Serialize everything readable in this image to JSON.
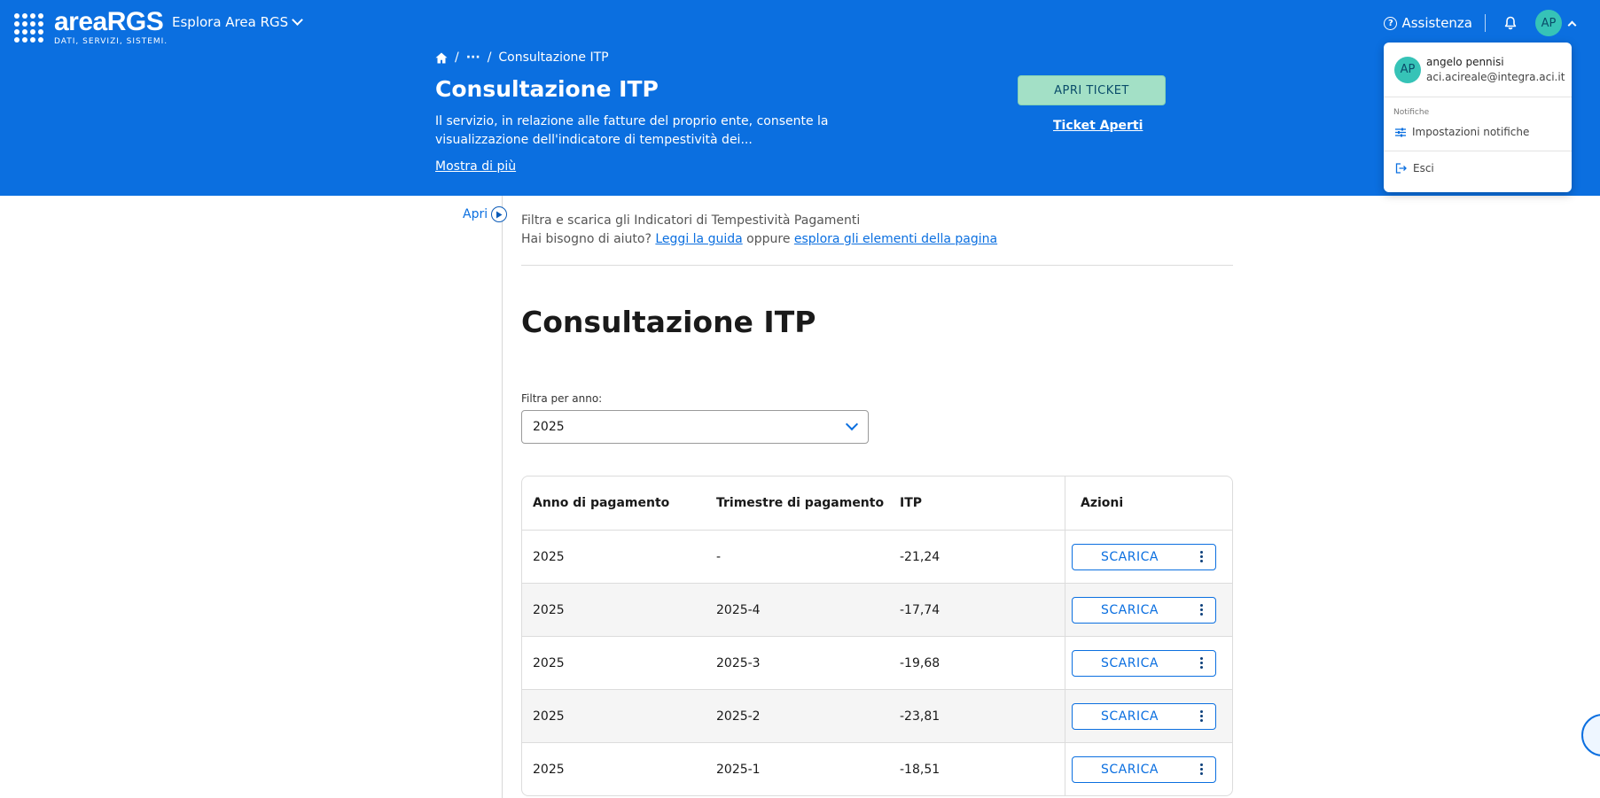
{
  "header": {
    "logo_word": "areaRGS",
    "logo_sub": "DATI, SERVIZI, SISTEMI.",
    "explore_label": "Esplora Area RGS",
    "assist_label": "Assistenza",
    "avatar_initials": "AP",
    "breadcrumb": {
      "ellipsis": "···",
      "sep": "/",
      "current": "Consultazione ITP"
    },
    "title": "Consultazione ITP",
    "description": "Il servizio, in relazione alle fatture del proprio ente, consente la visualizzazione dell'indicatore di tempestività dei...",
    "show_more": "Mostra di più",
    "ticket_button": "APRI TICKET",
    "ticket_link": "Ticket Aperti"
  },
  "user_menu": {
    "initials": "AP",
    "name": "angelo pennisi",
    "email": "aci.acireale@integra.aci.it",
    "section_label": "Notifiche",
    "notification_settings": "Impostazioni notifiche",
    "logout": "Esci"
  },
  "rail": {
    "open_label": "Apri"
  },
  "intro": {
    "line1": "Filtra e scarica gli Indicatori di Tempestività Pagamenti",
    "help_prefix": "Hai bisogno di aiuto?",
    "guide_link": "Leggi la guida",
    "connector": "oppure",
    "explore_link": "esplora gli elementi della pagina"
  },
  "main": {
    "title": "Consultazione ITP",
    "filter_label": "Filtra per anno:",
    "filter_value": "2025"
  },
  "table": {
    "headers": [
      "Anno di pagamento",
      "Trimestre di pagamento",
      "ITP",
      "Azioni"
    ],
    "action_label": "SCARICA",
    "rows": [
      {
        "anno": "2025",
        "trimestre": "-",
        "itp": "-21,24"
      },
      {
        "anno": "2025",
        "trimestre": "2025-4",
        "itp": "-17,74"
      },
      {
        "anno": "2025",
        "trimestre": "2025-3",
        "itp": "-19,68"
      },
      {
        "anno": "2025",
        "trimestre": "2025-2",
        "itp": "-23,81"
      },
      {
        "anno": "2025",
        "trimestre": "2025-1",
        "itp": "-18,51"
      }
    ]
  },
  "colors": {
    "brand_blue": "#0b6fe0",
    "ticket_green": "#a3e0c6",
    "avatar_teal": "#36c3b7"
  },
  "icons": [
    "home-icon",
    "help-circle-icon",
    "bell-icon",
    "chevron-down-icon",
    "chevron-up-icon",
    "sliders-icon",
    "logout-icon",
    "play-circle-icon",
    "kebab-icon"
  ]
}
